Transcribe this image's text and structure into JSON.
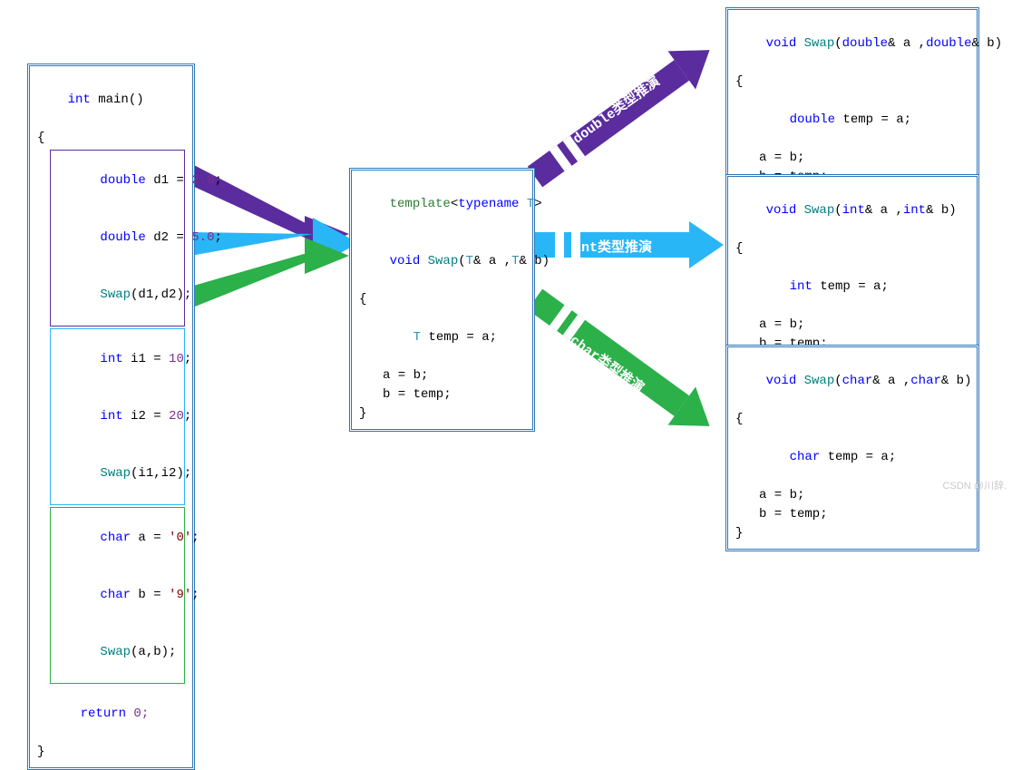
{
  "colors": {
    "box_border": "#2E75B6",
    "purple": "#5B2C9E",
    "cyan": "#29B6F6",
    "green": "#2BB04A",
    "blue_kw": "#0000FF",
    "teal_kw": "#008080",
    "tpl_kw": "#2E7D32",
    "type_T": "#2B91AF"
  },
  "main_box": {
    "sig_int": "int",
    "sig_main": " main()",
    "open": "{",
    "group_double": {
      "l1_kw": "double",
      "l1_rest": " d1 ",
      "l1_eq": "=",
      "l1_num": " 2.0",
      "l1_semi": ";",
      "l2_kw": "double",
      "l2_rest": " d2 ",
      "l2_eq": "=",
      "l2_num": " 5.0",
      "l2_semi": ";",
      "l3_fn": "Swap",
      "l3_args": "(d1,d2);"
    },
    "group_int": {
      "l1_kw": "int",
      "l1_rest": " i1 ",
      "l1_eq": "=",
      "l1_num": " 10",
      "l1_semi": ";",
      "l2_kw": "int",
      "l2_rest": " i2 ",
      "l2_eq": "=",
      "l2_num": " 20",
      "l2_semi": ";",
      "l3_fn": "Swap",
      "l3_args": "(i1,i2);"
    },
    "group_char": {
      "l1_kw": "char",
      "l1_rest": " a ",
      "l1_eq": "=",
      "l1_lit": " '0'",
      "l1_semi": ";",
      "l2_kw": "char",
      "l2_rest": " b ",
      "l2_eq": "=",
      "l2_lit": " '9'",
      "l2_semi": ";",
      "l3_fn": "Swap",
      "l3_args": "(a,b);"
    },
    "ret_kw": "return",
    "ret_val": " 0;",
    "close": "}"
  },
  "template_box": {
    "tpl": "template",
    "ang1": "<",
    "tn": "typename ",
    "T": "T",
    "ang2": ">",
    "void": "void",
    "sp": " ",
    "fn": "Swap",
    "sig": "(",
    "T2": "T",
    "r1": "& a ,",
    "T3": "T",
    "r2": "& b)",
    "open": "{",
    "body1_T": "T",
    "body1_rest": " temp = a;",
    "body2": "a = b;",
    "body3": "b = temp;",
    "close": "}"
  },
  "double_box": {
    "void": "void",
    "fn": " Swap",
    "sig_l": "(",
    "ty": "double",
    "amp1": "& a ,",
    "ty2": "double",
    "amp2": "& b)",
    "open": "{",
    "b1_ty": "double",
    "b1_rest": " temp = a;",
    "b2": "a = b;",
    "b3": "b = temp;",
    "close": "}"
  },
  "int_box": {
    "void": "void",
    "fn": " Swap",
    "sig_l": "(",
    "ty": "int",
    "amp1": "& a ,",
    "ty2": "int",
    "amp2": "& b)",
    "open": "{",
    "b1_ty": "int",
    "b1_rest": " temp = a;",
    "b2": "a = b;",
    "b3": "b = temp;",
    "close": "}"
  },
  "char_box": {
    "void": "void",
    "fn": " Swap",
    "sig_l": "(",
    "ty": "char",
    "amp1": "& a ,",
    "ty2": "char",
    "amp2": "& b)",
    "open": "{",
    "b1_ty": "char",
    "b1_rest": " temp = a;",
    "b2": "a = b;",
    "b3": "b = temp;",
    "close": "}"
  },
  "arrow_labels": {
    "double": "double类型推演",
    "int": "int类型推演",
    "char": "char类型推演"
  },
  "watermark": "CSDN @川辞."
}
